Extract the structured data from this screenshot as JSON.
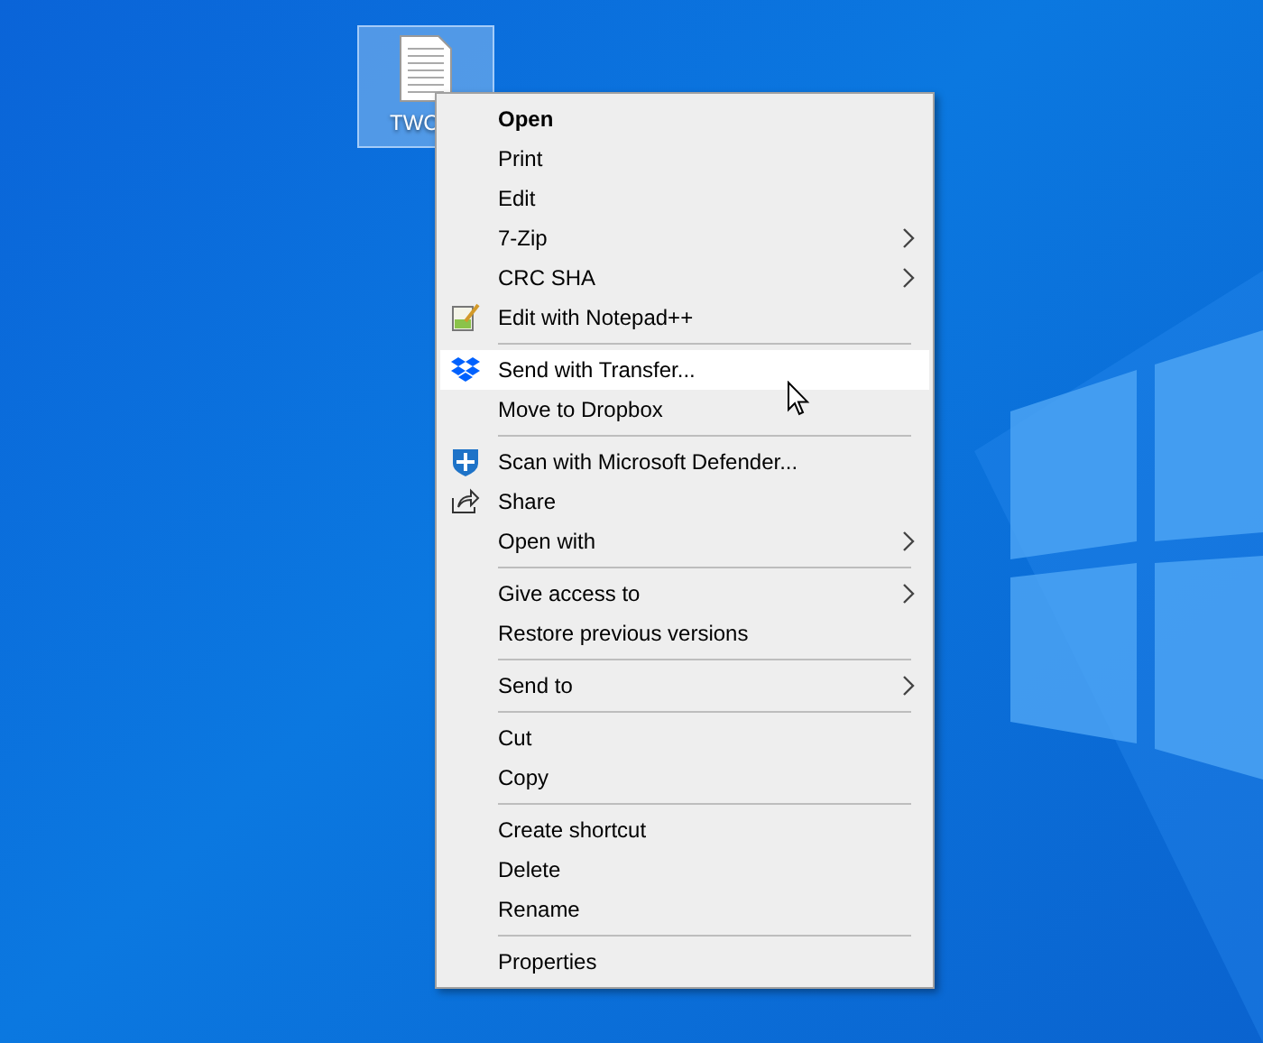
{
  "desktop_icon": {
    "label": "TWC"
  },
  "context_menu": {
    "groups": [
      {
        "items": [
          {
            "label": "Open",
            "bold": true,
            "submenu": false,
            "kind": "plain",
            "selected": false
          },
          {
            "label": "Print",
            "bold": false,
            "submenu": false,
            "kind": "plain",
            "selected": false
          },
          {
            "label": "Edit",
            "bold": false,
            "submenu": false,
            "kind": "plain",
            "selected": false
          },
          {
            "label": "7-Zip",
            "bold": false,
            "submenu": true,
            "kind": "plain",
            "selected": false
          },
          {
            "label": "CRC SHA",
            "bold": false,
            "submenu": true,
            "kind": "plain",
            "selected": false
          },
          {
            "label": "Edit with Notepad++",
            "bold": false,
            "submenu": false,
            "kind": "notepad",
            "selected": false
          }
        ]
      },
      {
        "items": [
          {
            "label": "Send with Transfer...",
            "bold": false,
            "submenu": false,
            "kind": "dropbox",
            "selected": true
          },
          {
            "label": "Move to Dropbox",
            "bold": false,
            "submenu": false,
            "kind": "plain",
            "selected": false
          }
        ]
      },
      {
        "items": [
          {
            "label": "Scan with Microsoft Defender...",
            "bold": false,
            "submenu": false,
            "kind": "shield",
            "selected": false
          },
          {
            "label": "Share",
            "bold": false,
            "submenu": false,
            "kind": "share",
            "selected": false
          },
          {
            "label": "Open with",
            "bold": false,
            "submenu": true,
            "kind": "plain",
            "selected": false
          }
        ]
      },
      {
        "items": [
          {
            "label": "Give access to",
            "bold": false,
            "submenu": true,
            "kind": "plain",
            "selected": false
          },
          {
            "label": "Restore previous versions",
            "bold": false,
            "submenu": false,
            "kind": "plain",
            "selected": false
          }
        ]
      },
      {
        "items": [
          {
            "label": "Send to",
            "bold": false,
            "submenu": true,
            "kind": "plain",
            "selected": false
          }
        ]
      },
      {
        "items": [
          {
            "label": "Cut",
            "bold": false,
            "submenu": false,
            "kind": "plain",
            "selected": false
          },
          {
            "label": "Copy",
            "bold": false,
            "submenu": false,
            "kind": "plain",
            "selected": false
          }
        ]
      },
      {
        "items": [
          {
            "label": "Create shortcut",
            "bold": false,
            "submenu": false,
            "kind": "plain",
            "selected": false
          },
          {
            "label": "Delete",
            "bold": false,
            "submenu": false,
            "kind": "plain",
            "selected": false
          },
          {
            "label": "Rename",
            "bold": false,
            "submenu": false,
            "kind": "plain",
            "selected": false
          }
        ]
      },
      {
        "items": [
          {
            "label": "Properties",
            "bold": false,
            "submenu": false,
            "kind": "plain",
            "selected": false
          }
        ]
      }
    ]
  }
}
